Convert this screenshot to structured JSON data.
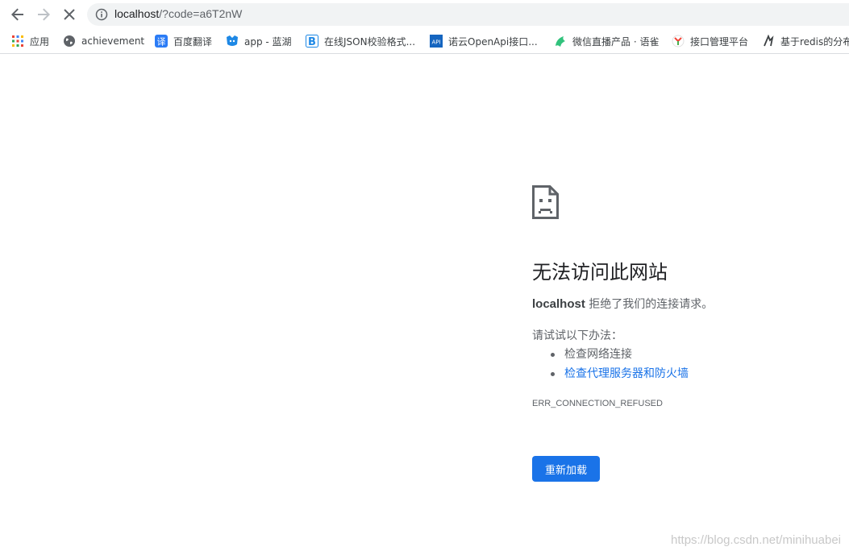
{
  "address_bar": {
    "host": "localhost",
    "path": "/?code=a6T2nW"
  },
  "bookmarks": [
    {
      "label": "应用",
      "icon": "apps-grid-icon"
    },
    {
      "label": "achievement",
      "icon": "globe-icon"
    },
    {
      "label": "百度翻译",
      "icon": "baidu-translate-icon"
    },
    {
      "label": "app - 蓝湖",
      "icon": "lanhu-icon"
    },
    {
      "label": "在线JSON校验格式...",
      "icon": "bejson-icon"
    },
    {
      "label": "诺云OpenApi接口...",
      "icon": "api-icon"
    },
    {
      "label": "微信直播产品 · 语雀",
      "icon": "yuque-icon"
    },
    {
      "label": "接口管理平台",
      "icon": "yapi-icon"
    },
    {
      "label": "基于redis的分布",
      "icon": "redis-icon"
    }
  ],
  "error": {
    "title": "无法访问此网站",
    "host": "localhost",
    "description": " 拒绝了我们的连接请求。",
    "try_label": "请试试以下办法：",
    "suggestions": {
      "check_network": "检查网络连接",
      "check_proxy": "检查代理服务器和防火墙"
    },
    "code": "ERR_CONNECTION_REFUSED",
    "reload_label": "重新加载"
  },
  "watermark": "https://blog.csdn.net/minihuabei",
  "colors": {
    "accent": "#1a73e8",
    "text_secondary": "#5f6368"
  }
}
